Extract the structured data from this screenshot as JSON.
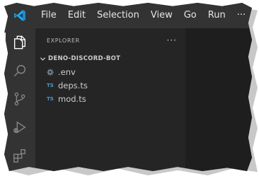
{
  "menubar": {
    "items": [
      "File",
      "Edit",
      "Selection",
      "View",
      "Go",
      "Run"
    ],
    "more": "···"
  },
  "activity_bar": {
    "icons": [
      "explorer-icon",
      "search-icon",
      "source-control-icon",
      "run-debug-icon",
      "extensions-icon"
    ],
    "active": "explorer-icon"
  },
  "sidebar": {
    "title": "EXPLORER",
    "more": "···",
    "folder": {
      "name": "DENO-DISCORD-BOT",
      "expanded": true
    },
    "files": [
      {
        "name": ".env",
        "icon": "gear-icon"
      },
      {
        "name": "deps.ts",
        "icon": "TS"
      },
      {
        "name": "mod.ts",
        "icon": "TS"
      }
    ]
  },
  "colors": {
    "titlebar": "#333333",
    "sidebar": "#252526",
    "editor": "#1e1e1e",
    "accent": "#23a9f2",
    "ts_icon": "#519aba"
  }
}
